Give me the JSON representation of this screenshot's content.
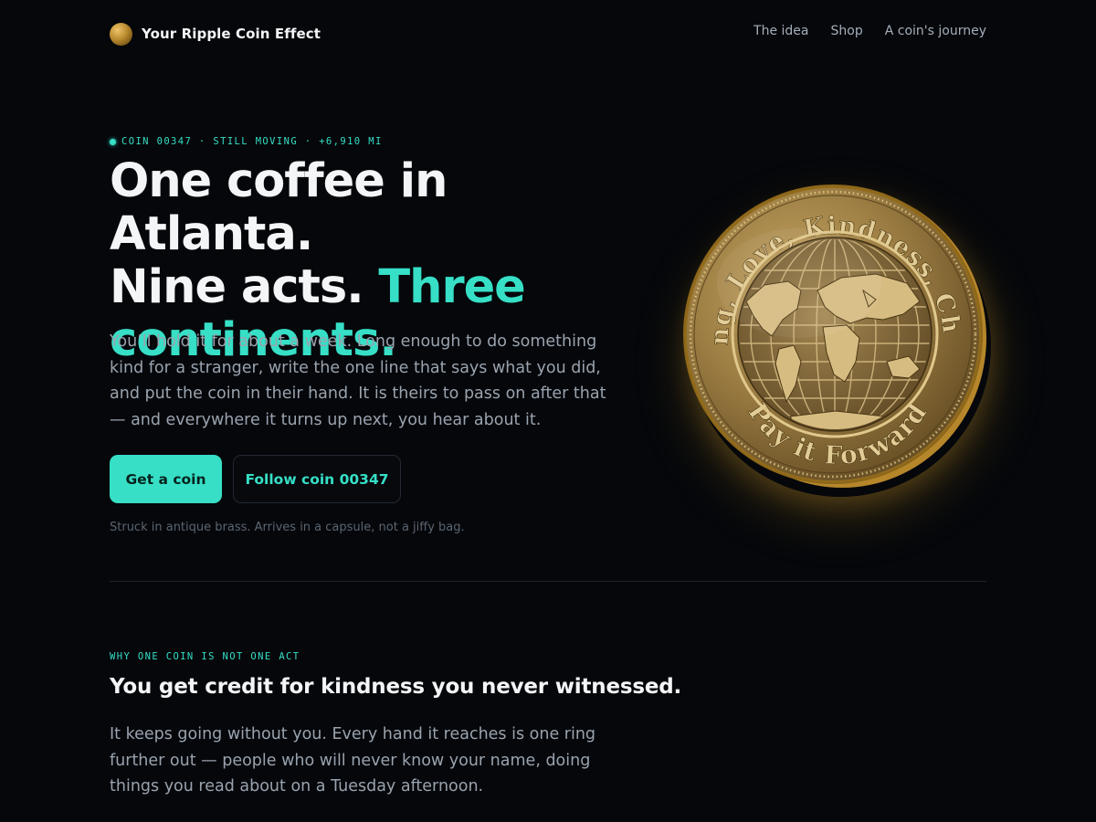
{
  "header": {
    "brand_name": "Your Ripple Coin Effect",
    "nav": [
      {
        "label": "The idea"
      },
      {
        "label": "Shop"
      },
      {
        "label": "A coin's journey"
      }
    ]
  },
  "hero": {
    "kicker": "COIN 00347 · STILL MOVING · +6,910 MI",
    "headline_line1": "One coffee in Atlanta.",
    "headline_line2_a": "Nine acts.",
    "headline_line2_b": "Three",
    "headline_line3": "continents.",
    "lede": "You’ll hold it for about a week. Long enough to do something kind for a stranger, write the one line that says what you did, and put the coin in their hand. It is theirs to pass on after that — and everywhere it turns up next, you hear about it.",
    "primary_button": "Get a coin",
    "secondary_button": "Follow coin 00347",
    "fineprint": "Struck in antique brass. Arrives in a capsule, not a jiffy bag."
  },
  "coin": {
    "top_inscription": "Giving, Love, Kindness, Charity",
    "bottom_inscription": "Pay it Forward"
  },
  "section_why": {
    "eyebrow": "WHY ONE COIN IS NOT ONE ACT",
    "title": "You get credit for kindness you never witnessed.",
    "body": "It keeps going without you. Every hand it reaches is one ring further out — people who will never know your name, doing things you read about on a Tuesday afternoon."
  },
  "colors": {
    "background": "#05070b",
    "accent": "#36dfc6",
    "brass": "#b98a2e",
    "text_primary": "#f3f5f7",
    "text_secondary": "#9aa3ae"
  }
}
